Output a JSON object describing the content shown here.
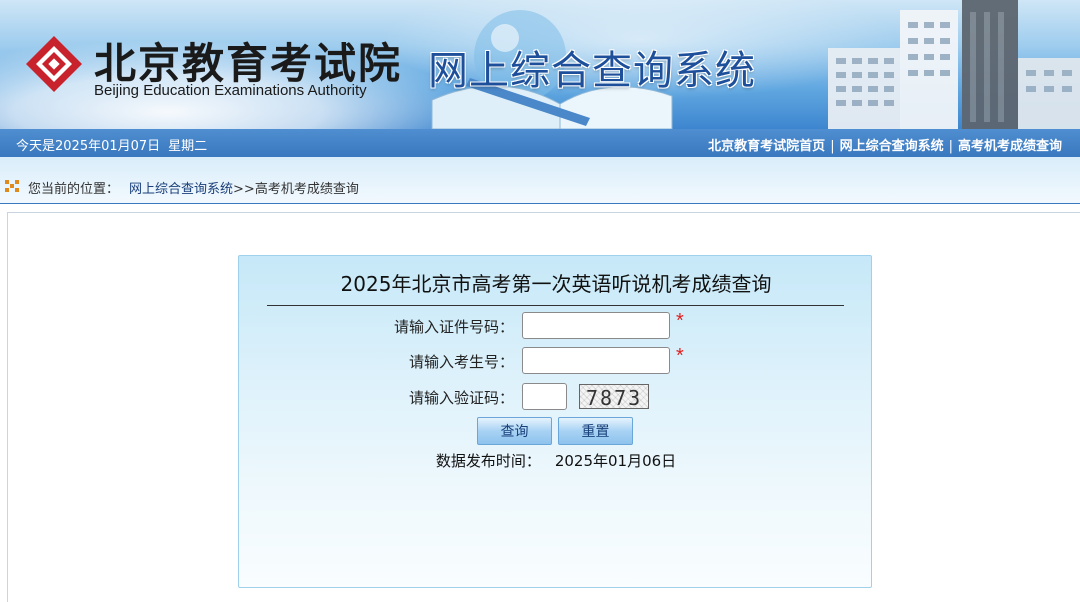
{
  "header": {
    "org_name_cn": "北京教育考试院",
    "org_name_en": "Beijing Education Examinations Authority",
    "system_title": "网上综合查询系统"
  },
  "navbar": {
    "date_text": "今天是2025年01月07日",
    "weekday": "星期二",
    "links": [
      "北京教育考试院首页",
      "网上综合查询系统",
      "高考机考成绩查询"
    ],
    "separator": "|"
  },
  "breadcrumb": {
    "prefix": "您当前的位置：",
    "link": "网上综合查询系统",
    "current": ">>高考机考成绩查询"
  },
  "query_form": {
    "title": "2025年北京市高考第一次英语听说机考成绩查询",
    "id_label": "请输入证件号码：",
    "id_value": "",
    "exam_no_label": "请输入考生号：",
    "exam_no_value": "",
    "captcha_label": "请输入验证码：",
    "captcha_value": "",
    "captcha_code": "7873",
    "required_mark": "*",
    "submit_label": "查询",
    "reset_label": "重置",
    "publish_label": "数据发布时间：",
    "publish_date": "2025年01月06日"
  },
  "colors": {
    "nav_blue": "#3a78bf",
    "title_blue": "#1d4f9a",
    "logo_red": "#c8232c",
    "required_red": "#e02020",
    "panel_bg": "#c6e8f8"
  }
}
